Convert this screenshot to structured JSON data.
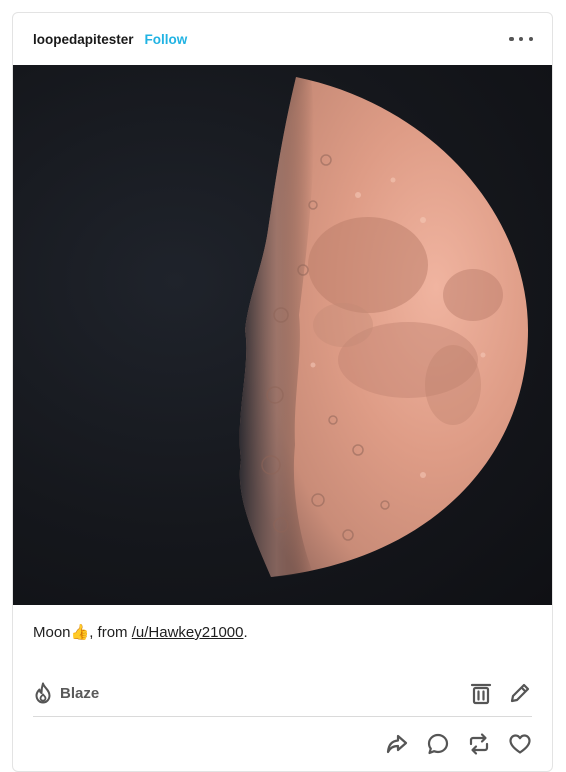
{
  "post": {
    "author": "loopedapitester",
    "follow_label": "Follow",
    "more_icon": "more-horizontal-icon",
    "image_alt": "Half moon photographed against a dark sky",
    "caption": {
      "text_before": "Moon",
      "emoji": "👍",
      "text_middle": ", from ",
      "link": "/u/Hawkey21000",
      "text_after": "."
    }
  },
  "actions": {
    "blaze_label": "Blaze",
    "blaze_icon": "flame-icon",
    "delete_icon": "trash-icon",
    "edit_icon": "pencil-icon",
    "share_icon": "share-icon",
    "reply_icon": "comment-icon",
    "reblog_icon": "reblog-icon",
    "like_icon": "heart-icon"
  },
  "colors": {
    "follow": "#21b3e3",
    "icon": "#555555",
    "divider": "#dadada"
  }
}
